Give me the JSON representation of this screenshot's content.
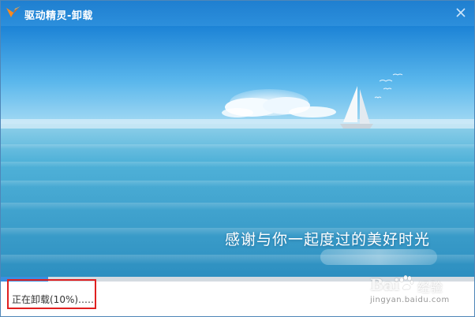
{
  "window": {
    "title": "驱动精灵-卸载",
    "accent": "#2c8fdc",
    "close_icon": "close-icon",
    "logo_icon": "drive-genius-logo-icon"
  },
  "banner": {
    "slogan": "感谢与你一起度过的美好时光"
  },
  "progress": {
    "fraction": 0.1,
    "status_text": "正在卸载(10%)……"
  },
  "watermark": {
    "brand": "Bai",
    "brand_cn": "经验",
    "url": "jingyan.baidu.com"
  }
}
